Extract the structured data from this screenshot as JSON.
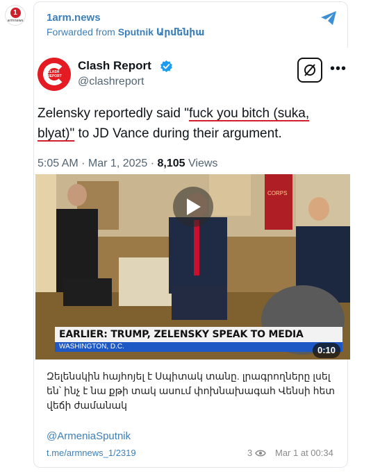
{
  "channel": {
    "name": "1arm.news",
    "forwarded_prefix": "Forwarded from",
    "forwarded_source": "Sputnik Արմենիա",
    "avatar_text": "armnews",
    "avatar_symbol": "1"
  },
  "tweet": {
    "author": "Clash Report",
    "handle": "@clashreport",
    "avatar_text": "CLASH REPORT",
    "text_part1": "Zelensky reportedly said \"",
    "text_underlined1": "fuck you bitch (suka,",
    "text_underlined2": "blyat)\"",
    "text_part2": " to JD Vance during their argument.",
    "time": "5:05 AM · Mar 1, 2025 · ",
    "views_count": "8,105",
    "views_label": " Views"
  },
  "video": {
    "headline": "EARLIER: TRUMP, ZELENSKY SPEAK TO MEDIA",
    "location": "WASHINGTON, D.C.",
    "duration": "0:10",
    "flag_text": "CORPS"
  },
  "post": {
    "caption": "Զելենսկին հայհոյել է Սպիտակ տանը. լրագրողները լսել են՝ ինչ է նա քթի տակ ասում փոխնախագահ Վենսի հետ վեճի ժամանակ",
    "mention": "@ArmeniaSputnik",
    "link": "t.me/armnews_1/2319",
    "views": "3",
    "date": "Mar 1 at 00:34"
  },
  "colors": {
    "link_blue": "#3d7fb8",
    "underline_red": "#d11f2c",
    "clash_red": "#e41b23",
    "verified_blue": "#1d9bf0"
  },
  "icons": [
    "share-icon",
    "verified-icon",
    "grok-icon",
    "more-icon",
    "play-icon",
    "eye-icon"
  ]
}
